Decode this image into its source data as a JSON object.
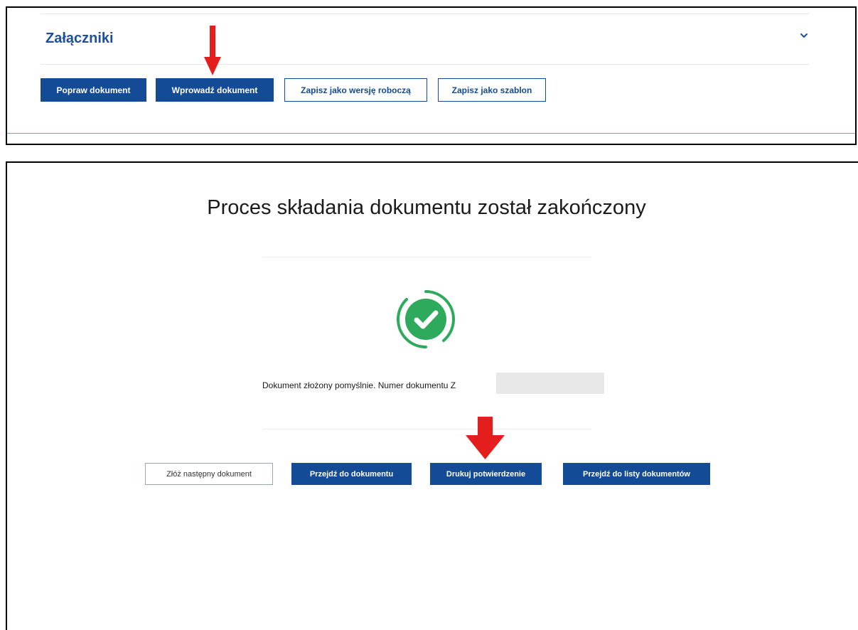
{
  "top_panel": {
    "section_title": "Załączniki",
    "chevron_icon": "chevron-down-icon",
    "buttons": {
      "popraw": "Popraw dokument",
      "wprowadz": "Wprowadź dokument",
      "wersja_robocza": "Zapisz jako wersję roboczą",
      "szablon": "Zapisz jako szablon"
    }
  },
  "bottom_panel": {
    "title": "Proces składania dokumentu został zakończony",
    "status_icon": "check-circle-icon",
    "message": "Dokument złożony pomyślnie. Numer dokumentu Z",
    "buttons": {
      "zloz_nastepny": "Złóż następny dokument",
      "przejdz_do_dokumentu": "Przejdź do dokumentu",
      "drukuj": "Drukuj potwierdzenie",
      "lista": "Przejdź do listy dokumentów"
    }
  },
  "annotations": {
    "arrow_icon": "red-down-arrow-icon"
  },
  "colors": {
    "primary_blue": "#144b96",
    "title_blue": "#1c4f9c",
    "success_green": "#2eaa5c",
    "arrow_red": "#e41d1d",
    "divider_pink": "#d97a92"
  }
}
